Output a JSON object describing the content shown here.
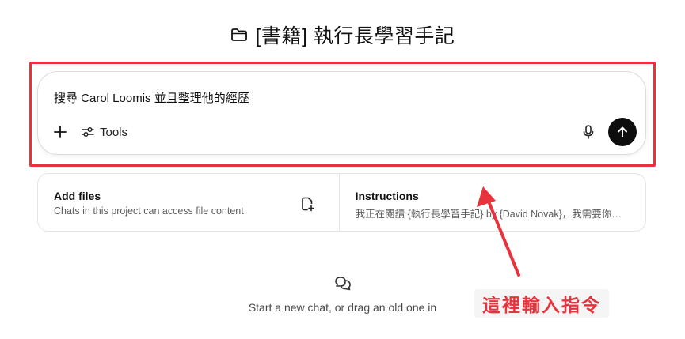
{
  "project": {
    "title": "[書籍] 執行長學習手記",
    "icon": "folder-icon"
  },
  "composer": {
    "prompt_text": "搜尋 Carol Loomis 並且整理他的經歷",
    "tools_label": "Tools",
    "icons": [
      "plus-icon",
      "tools-sliders-icon",
      "microphone-icon",
      "send-arrow-up-icon"
    ]
  },
  "cards": {
    "files": {
      "title": "Add files",
      "subtitle": "Chats in this project can access file content",
      "icon": "add-file-icon"
    },
    "instructions": {
      "title": "Instructions",
      "subtitle": "我正在閱讀 {執行長學習手記} by {David Novak}，我需要你協…"
    }
  },
  "empty_state": {
    "icon": "chat-bubbles-icon",
    "message": "Start a new chat, or drag an old one in"
  },
  "annotation": {
    "callout_text": "這裡輸入指令",
    "color": "#e8323c"
  }
}
